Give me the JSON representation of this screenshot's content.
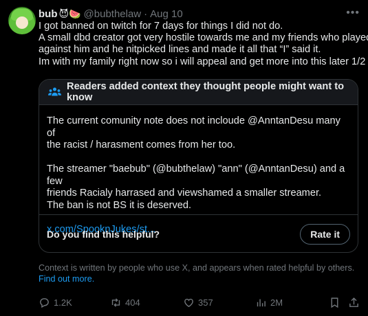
{
  "author": {
    "name": "bub",
    "emojis": "😈🍉",
    "handle": "@bubthelaw",
    "separator": "·",
    "date": "Aug 10"
  },
  "more_icon": "•••",
  "tweet": {
    "lines": [
      "I got banned on twitch for 7 days for things I did not do.",
      "A small dbd creator got very hostile towards me and my friends who played",
      "against him and he nitpicked lines and made it all that “I” said it.",
      "Im with my family right now so i will appeal and get more into this later 1/2"
    ]
  },
  "note": {
    "title": "Readers added context they thought people might want to know",
    "para1": [
      "The current comunity note does not incloude @AnntanDesu many of",
      "the racist / harasment comes from her too."
    ],
    "para2": [
      "The streamer \"baebub\" (@bubthelaw)  \"ann\" (@AnntanDesu) and a few",
      "friends Racialy harrased and viewshamed a smaller streamer.",
      "The ban is not BS it is deserved."
    ],
    "link": "x.com/SpooknJukes/st...",
    "question": "Do you find this helpful?",
    "rate_label": "Rate it"
  },
  "context_footer": {
    "text": "Context is written by people who use X, and appears when rated helpful by others.",
    "link": "Find out more."
  },
  "actions": {
    "replies": "1.2K",
    "reposts": "404",
    "likes": "357",
    "views": "2M"
  },
  "colors": {
    "background": "#000000",
    "text": "#e7e9ea",
    "muted": "#71767b",
    "accent": "#1d9bf0",
    "border": "#2f3336"
  }
}
